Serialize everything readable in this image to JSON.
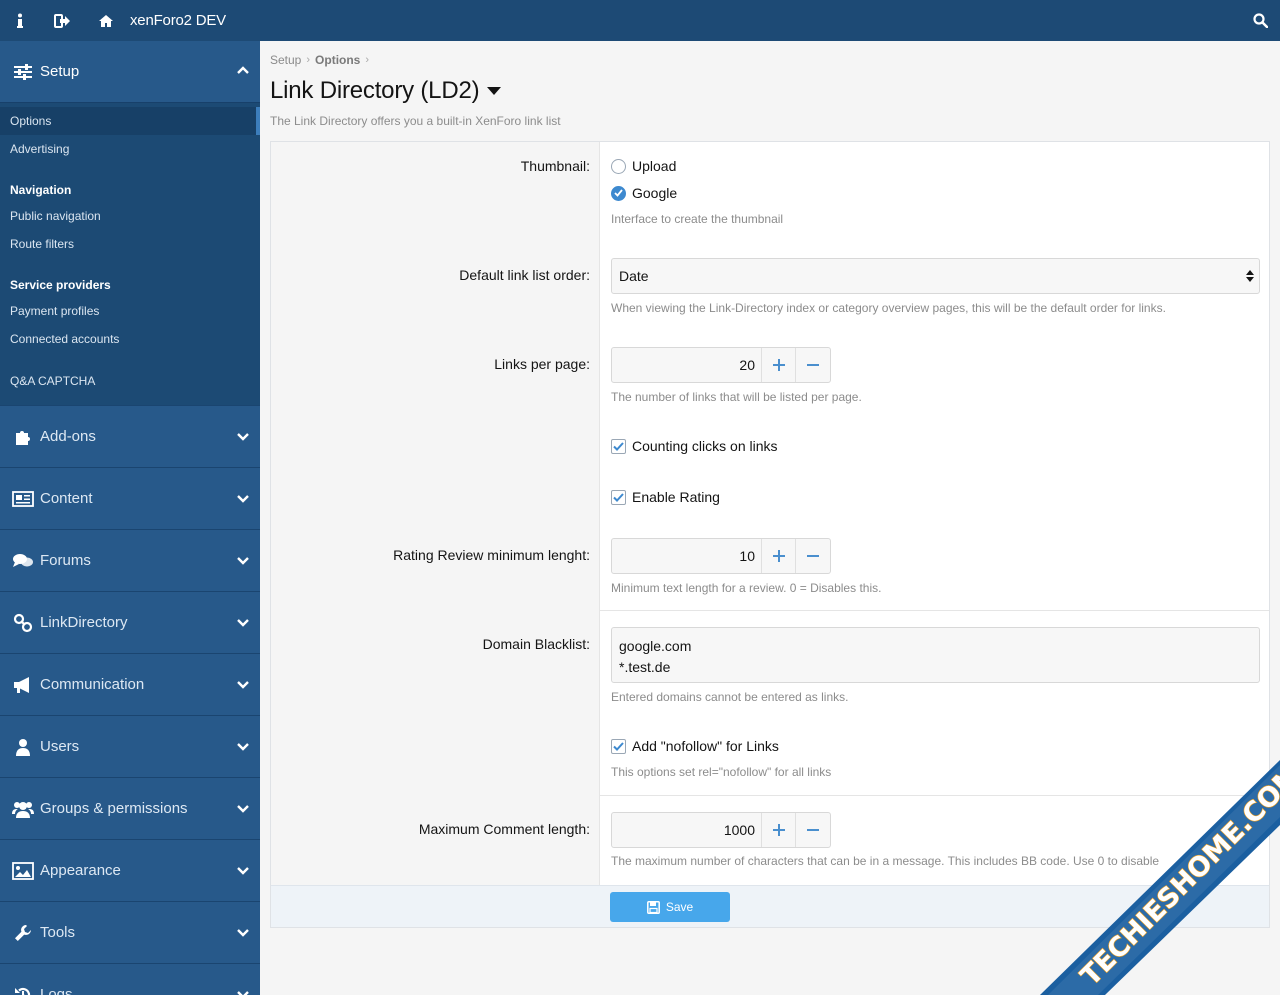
{
  "topbar": {
    "title": "xenForo2 DEV"
  },
  "sidebar": {
    "head": "Setup",
    "items": [
      "Options",
      "Advertising"
    ],
    "groups": [
      {
        "title": "Navigation",
        "items": [
          "Public navigation",
          "Route filters"
        ]
      },
      {
        "title": "Service providers",
        "items": [
          "Payment profiles",
          "Connected accounts"
        ]
      }
    ],
    "extra": "Q&A CAPTCHA",
    "sections": [
      "Add-ons",
      "Content",
      "Forums",
      "LinkDirectory",
      "Communication",
      "Users",
      "Groups & permissions",
      "Appearance",
      "Tools",
      "Logs"
    ]
  },
  "breadcrumb": {
    "root": "Setup",
    "current": "Options"
  },
  "page": {
    "title": "Link Directory (LD2)",
    "description": "The Link Directory offers you a built-in XenForo link list"
  },
  "form": {
    "thumbnail": {
      "label": "Thumbnail:",
      "options": [
        "Upload",
        "Google"
      ],
      "selected": "Google",
      "hint": "Interface to create the thumbnail"
    },
    "order": {
      "label": "Default link list order:",
      "value": "Date",
      "hint": "When viewing the Link-Directory index or category overview pages, this will be the default order for links."
    },
    "links_per_page": {
      "label": "Links per page:",
      "value": "20",
      "hint": "The number of links that will be listed per page."
    },
    "counting_clicks": {
      "label": "Counting clicks on links",
      "checked": true
    },
    "enable_rating": {
      "label": "Enable Rating",
      "checked": true
    },
    "rating_min": {
      "label": "Rating Review minimum lenght:",
      "value": "10",
      "hint": "Minimum text length for a review. 0 = Disables this."
    },
    "blacklist": {
      "label": "Domain Blacklist:",
      "value": "google.com\n*.test.de",
      "hint": "Entered domains cannot be entered as links."
    },
    "nofollow": {
      "label": "Add \"nofollow\" for Links",
      "checked": true,
      "hint": "This options set rel=\"nofollow\" for all links"
    },
    "max_comment": {
      "label": "Maximum Comment length:",
      "value": "1000",
      "hint": "The maximum number of characters that can be in a message. This includes BB code. Use 0 to disable"
    },
    "save_label": "Save"
  },
  "watermark": "TECHIESHOME.COM",
  "colors": {
    "topbar": "#1d4a75",
    "sidebar": "#1c4a74",
    "accent": "#3d89cf",
    "save": "#47a7eb"
  }
}
